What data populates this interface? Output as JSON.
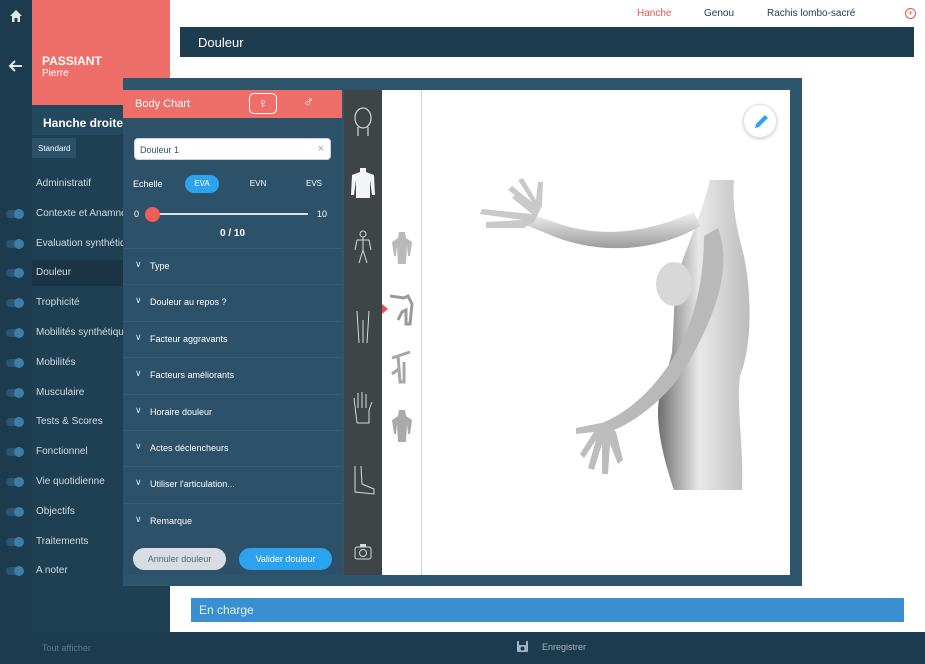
{
  "patient": {
    "last_name": "PASSIANT",
    "first_name": "Pierre"
  },
  "joint_title": "Hanche droite",
  "standard_tab": "Standard",
  "nav_items": [
    {
      "label": "Administratif",
      "toggle": false
    },
    {
      "label": "Contexte et Anamnèse",
      "toggle": true
    },
    {
      "label": "Evaluation synthétique",
      "toggle": true
    },
    {
      "label": "Douleur",
      "toggle": true,
      "active": true
    },
    {
      "label": "Trophicité",
      "toggle": true
    },
    {
      "label": "Mobilités synthétiques",
      "toggle": true
    },
    {
      "label": "Mobilités",
      "toggle": true
    },
    {
      "label": "Musculaire",
      "toggle": true
    },
    {
      "label": "Tests & Scores",
      "toggle": true
    },
    {
      "label": "Fonctionnel",
      "toggle": true
    },
    {
      "label": "Vie quotidienne",
      "toggle": true
    },
    {
      "label": "Objectifs",
      "toggle": true
    },
    {
      "label": "Traitements",
      "toggle": true
    },
    {
      "label": "A noter",
      "toggle": true
    }
  ],
  "top_tabs": [
    "Hanche",
    "Genou",
    "Rachis lombo-sacré"
  ],
  "header_title": "Douleur",
  "charge_label": "En charge",
  "bottom": {
    "see_label": "Tout afficher",
    "save_label": "Enregistrer"
  },
  "body_chart": {
    "title": "Body Chart",
    "female_symbol": "♀",
    "male_symbol": "♂",
    "pain_name": "Douleur 1",
    "clear_symbol": "×",
    "scale_label": "Echelle",
    "scales": [
      "EVA",
      "EVN",
      "EVS"
    ],
    "active_scale": "EVA",
    "slider": {
      "min": "0",
      "max": "10",
      "value": 0,
      "value_text": "0 / 10"
    },
    "sections": [
      "Type",
      "Douleur au repos ?",
      "Facteur aggravants",
      "Facteurs améliorants",
      "Horaire douleur",
      "Actes déclencheurs",
      "Utiliser l'articulation...",
      "Remarque"
    ],
    "cancel_label": "Annuler douleur",
    "validate_label": "Valider douleur"
  },
  "colors": {
    "accent": "#ee6f6a",
    "primary": "#2da3f0",
    "panel": "#2c5169",
    "nav": "#1f3f53"
  },
  "icons": [
    "home-icon",
    "back-arrow-icon",
    "female-icon",
    "male-icon",
    "clear-icon",
    "chevron-down-icon",
    "head-view-icon",
    "torso-view-icon",
    "full-body-view-icon",
    "leg-view-icon",
    "hand-view-icon",
    "foot-view-icon",
    "camera-icon",
    "pencil-icon",
    "save-icon",
    "plus-circle-icon"
  ]
}
